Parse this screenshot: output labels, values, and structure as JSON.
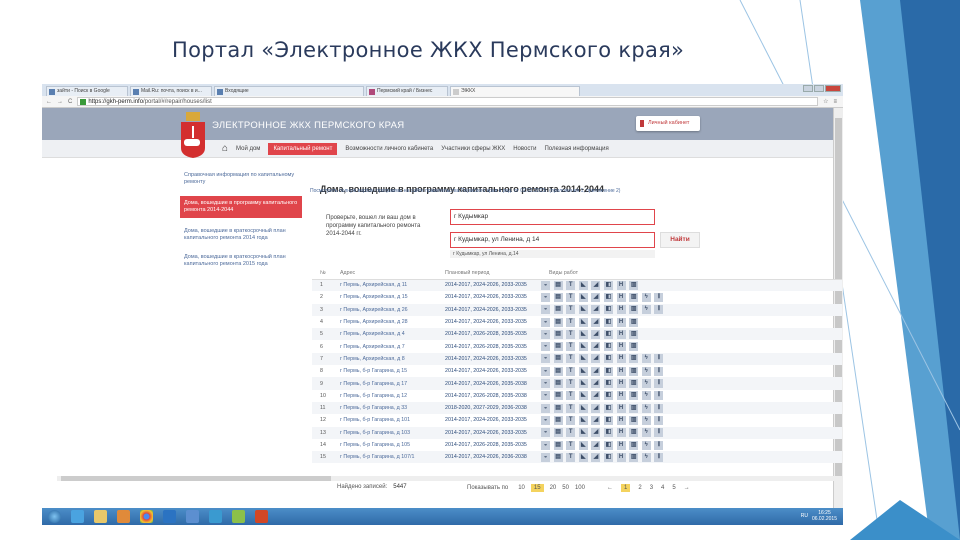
{
  "slide_title": "Портал «Электронное ЖКХ Пермского края»",
  "browser": {
    "tabs": [
      "зайти - Поиск в Google",
      "Mail.Ru: почта, поиск в и...",
      "Входящие",
      "Пермский край / Бизнес",
      "ЭЖКХ"
    ],
    "url_host": "https://gkh-perm.info",
    "url_path": "/portal/#/repair/houses/list"
  },
  "site": {
    "name": "ЭЛЕКТРОННОЕ ЖКХ ПЕРМСКОГО КРАЯ",
    "cabinet": "Личный кабинет",
    "nav": [
      "Мой дом",
      "Капитальный ремонт",
      "Возможности личного кабинета",
      "Участники сферы ЖКХ",
      "Новости",
      "Полезная информация"
    ]
  },
  "sidebar": [
    "Справочная информация по капитальному ремонту",
    "Дома, вошедшие в программу капитального ремонта 2014-2044",
    "Дома, вошедшие в краткосрочный план капитального ремонта 2014 года",
    "Дома, вошедшие в краткосрочный план капитального ремонта 2015 года"
  ],
  "main": {
    "title": "Дома, вошедшие в программу капитального ремонта 2014-2044",
    "subtitle": "Посмотреть полную версию программы на сайте правительства Пермского края в ред. от 02.02.2015г. (приложения 1, приложение 2)",
    "check_label": "Проверьте, вошел ли ваш дом в программу капитального ремонта 2014-2044 гг.",
    "city_input": "г Кудымкар",
    "address_input": "г Кудымкар, ул Ленина, д 14",
    "suggestion": "г Кудымкар, ул Ленина, д.14",
    "find_button": "Найти"
  },
  "table": {
    "headers": [
      "№",
      "Адрес",
      "Плановый период",
      "Виды работ"
    ],
    "rows": [
      {
        "n": "1",
        "addr": "г Пермь, Архирейская, д 11",
        "period": "2014-2017, 2024-2026, 2033-2035",
        "works": 8
      },
      {
        "n": "2",
        "addr": "г Пермь, Архирейская, д 15",
        "period": "2014-2017, 2024-2026, 2033-2035",
        "works": 10
      },
      {
        "n": "3",
        "addr": "г Пермь, Архирейская, д 26",
        "period": "2014-2017, 2024-2026, 2033-2035",
        "works": 10
      },
      {
        "n": "4",
        "addr": "г Пермь, Архирейская, д 28",
        "period": "2014-2017, 2024-2026, 2033-2035",
        "works": 8
      },
      {
        "n": "5",
        "addr": "г Пермь, Архирейская, д 4",
        "period": "2014-2017, 2026-2028, 2035-2035",
        "works": 8
      },
      {
        "n": "6",
        "addr": "г Пермь, Архирейская, д 7",
        "period": "2014-2017, 2026-2028, 2035-2035",
        "works": 8
      },
      {
        "n": "7",
        "addr": "г Пермь, Архирейская, д 8",
        "period": "2014-2017, 2024-2026, 2033-2035",
        "works": 10
      },
      {
        "n": "8",
        "addr": "г Пермь, б-р Гагарина, д 15",
        "period": "2014-2017, 2024-2026, 2033-2035",
        "works": 10
      },
      {
        "n": "9",
        "addr": "г Пермь, б-р Гагарина, д 17",
        "period": "2014-2017, 2024-2026, 2035-2038",
        "works": 10
      },
      {
        "n": "10",
        "addr": "г Пермь, б-р Гагарина, д 12",
        "period": "2014-2017, 2026-2028, 2035-2038",
        "works": 10
      },
      {
        "n": "11",
        "addr": "г Пермь, б-р Гагарина, д 33",
        "period": "2018-2020, 2027-2029, 2036-2038",
        "works": 10
      },
      {
        "n": "12",
        "addr": "г Пермь, б-р Гагарина, д 101",
        "period": "2014-2017, 2024-2026, 2033-2035",
        "works": 10
      },
      {
        "n": "13",
        "addr": "г Пермь, б-р Гагарина, д 103",
        "period": "2014-2017, 2024-2026, 2033-2035",
        "works": 10
      },
      {
        "n": "14",
        "addr": "г Пермь, б-р Гагарина, д 105",
        "period": "2014-2017, 2026-2028, 2035-2035",
        "works": 10
      },
      {
        "n": "15",
        "addr": "г Пермь, б-р Гагарина, д 107/1",
        "period": "2014-2017, 2024-2026, 2036-2038",
        "works": 10
      }
    ]
  },
  "footer": {
    "found_label": "Найдено записей:",
    "found": "5447",
    "per_page_label": "Показывать по",
    "per_page": [
      "10",
      "15",
      "20",
      "50",
      "100"
    ],
    "pages": [
      "1",
      "2",
      "3",
      "4",
      "5"
    ],
    "prev": "←",
    "next": "→"
  },
  "taskbar": {
    "lang": "RU",
    "time": "16:25",
    "date": "06.02.2015"
  }
}
